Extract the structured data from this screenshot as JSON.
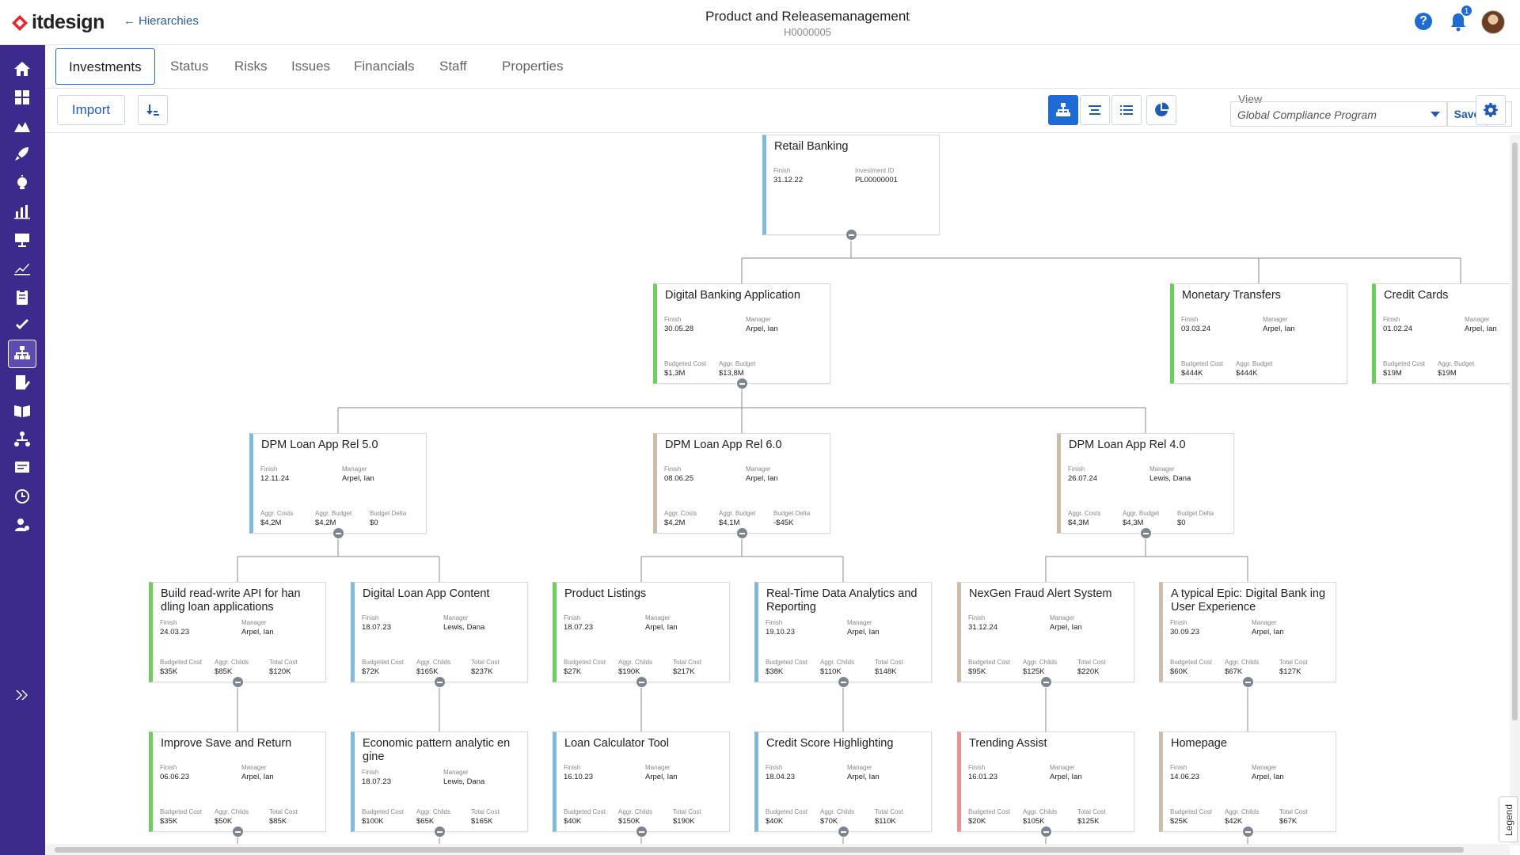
{
  "app": {
    "brand": "itdesign",
    "back_label": "Hierarchies",
    "title": "Product and Releasemanagement",
    "subtitle": "H0000005",
    "help_label": "?",
    "notifications_count": "1"
  },
  "tabs": [
    {
      "label": "Investments",
      "active": true
    },
    {
      "label": "Status",
      "active": false
    },
    {
      "label": "Risks",
      "active": false
    },
    {
      "label": "Issues",
      "active": false
    },
    {
      "label": "Financials",
      "active": false
    },
    {
      "label": "Staff",
      "active": false
    },
    {
      "label": "Properties",
      "active": false
    }
  ],
  "toolbar": {
    "import_label": "Import",
    "view_label": "View",
    "view_value": "Global Compliance Program",
    "save_label": "Save"
  },
  "legend_label": "Legend",
  "colors": {
    "sidebar": "#3d2a8c",
    "accent": "#1e6bd6",
    "green": "#6ccf5b",
    "blue": "#7fbad9",
    "tan": "#cbbda9",
    "red": "#ef8f8f"
  },
  "sidebar_icons": [
    "home-icon",
    "dashboard-icon",
    "landscape-icon",
    "rocket-icon",
    "idea-icon",
    "bar-chart-icon",
    "presentation-icon",
    "line-chart-icon",
    "clipboard-icon",
    "check-icon",
    "hierarchy-icon",
    "report-edit-icon",
    "book-icon",
    "org-chart-icon",
    "form-icon",
    "clock-icon",
    "settings-user-icon",
    "expand-icon"
  ],
  "nodes": [
    {
      "title": "Retail Banking",
      "color": "blue",
      "fields": [
        [
          "Finish",
          "31.12.22"
        ],
        [
          "Investment ID",
          "PL00000001"
        ]
      ],
      "bottom": []
    },
    {
      "title": "Digital Banking Application",
      "color": "green",
      "fields": [
        [
          "Finish",
          "30.05.28"
        ],
        [
          "Manager",
          "Arpel, Ian"
        ]
      ],
      "bottom": [
        [
          "Budgeted Cost",
          "$1,3M"
        ],
        [
          "Aggr. Budget",
          "$13,8M"
        ]
      ]
    },
    {
      "title": "Monetary Transfers",
      "color": "green",
      "fields": [
        [
          "Finish",
          "03.03.24"
        ],
        [
          "Manager",
          "Arpel, Ian"
        ]
      ],
      "bottom": [
        [
          "Budgeted Cost",
          "$444K"
        ],
        [
          "Aggr. Budget",
          "$444K"
        ]
      ]
    },
    {
      "title": "Credit Cards",
      "color": "green",
      "fields": [
        [
          "Finish",
          "01.02.24"
        ],
        [
          "Manager",
          "Arpel, Ian"
        ]
      ],
      "bottom": [
        [
          "Budgeted Cost",
          "$19M"
        ],
        [
          "Aggr. Budget",
          "$19M"
        ]
      ]
    },
    {
      "title": "DPM Loan App Rel 5.0",
      "color": "blue",
      "fields": [
        [
          "Finish",
          "12.11.24"
        ],
        [
          "Manager",
          "Arpel, Ian"
        ]
      ],
      "bottom": [
        [
          "Aggr. Costs",
          "$4,2M"
        ],
        [
          "Aggr. Budget",
          "$4,2M"
        ],
        [
          "Budget Delta",
          "$0"
        ]
      ]
    },
    {
      "title": "DPM Loan App Rel 6.0",
      "color": "tan",
      "fields": [
        [
          "Finish",
          "08.06.25"
        ],
        [
          "Manager",
          "Arpel, Ian"
        ]
      ],
      "bottom": [
        [
          "Aggr. Costs",
          "$4,2M"
        ],
        [
          "Aggr. Budget",
          "$4,1M"
        ],
        [
          "Budget Delta",
          "-$45K"
        ]
      ]
    },
    {
      "title": "DPM Loan App Rel 4.0",
      "color": "tan",
      "fields": [
        [
          "Finish",
          "26.07.24"
        ],
        [
          "Manager",
          "Lewis, Dana"
        ]
      ],
      "bottom": [
        [
          "Aggr. Costs",
          "$4,3M"
        ],
        [
          "Aggr. Budget",
          "$4,3M"
        ],
        [
          "Budget Delta",
          "$0"
        ]
      ]
    },
    {
      "title": "Build read-write API for han dling loan applications",
      "color": "green",
      "fields": [
        [
          "Finish",
          "24.03.23"
        ],
        [
          "Manager",
          "Arpel, Ian"
        ]
      ],
      "bottom": [
        [
          "Budgeted Cost",
          "$35K"
        ],
        [
          "Aggr. Childs",
          "$85K"
        ],
        [
          "Total Cost",
          "$120K"
        ]
      ]
    },
    {
      "title": "Digital Loan App Content",
      "color": "blue",
      "fields": [
        [
          "Finish",
          "18.07.23"
        ],
        [
          "Manager",
          "Lewis, Dana"
        ]
      ],
      "bottom": [
        [
          "Budgeted Cost",
          "$72K"
        ],
        [
          "Aggr. Childs",
          "$165K"
        ],
        [
          "Total Cost",
          "$237K"
        ]
      ]
    },
    {
      "title": "Product Listings",
      "color": "green",
      "fields": [
        [
          "Finish",
          "18.07.23"
        ],
        [
          "Manager",
          "Arpel, Ian"
        ]
      ],
      "bottom": [
        [
          "Budgeted Cost",
          "$27K"
        ],
        [
          "Aggr. Childs",
          "$190K"
        ],
        [
          "Total Cost",
          "$217K"
        ]
      ]
    },
    {
      "title": "Real-Time Data Analytics and Reporting",
      "color": "blue",
      "fields": [
        [
          "Finish",
          "19.10.23"
        ],
        [
          "Manager",
          "Arpel, Ian"
        ]
      ],
      "bottom": [
        [
          "Budgeted Cost",
          "$38K"
        ],
        [
          "Aggr. Childs",
          "$110K"
        ],
        [
          "Total Cost",
          "$148K"
        ]
      ]
    },
    {
      "title": "NexGen Fraud Alert System",
      "color": "tan",
      "fields": [
        [
          "Finish",
          "31.12.24"
        ],
        [
          "Manager",
          "Arpel, Ian"
        ]
      ],
      "bottom": [
        [
          "Budgeted Cost",
          "$95K"
        ],
        [
          "Aggr. Childs",
          "$125K"
        ],
        [
          "Total Cost",
          "$220K"
        ]
      ]
    },
    {
      "title": "A typical Epic: Digital Bank ing User Experience",
      "color": "tan",
      "fields": [
        [
          "Finish",
          "30.09.23"
        ],
        [
          "Manager",
          "Arpel, Ian"
        ]
      ],
      "bottom": [
        [
          "Budgeted Cost",
          "$60K"
        ],
        [
          "Aggr. Childs",
          "$67K"
        ],
        [
          "Total Cost",
          "$127K"
        ]
      ]
    },
    {
      "title": "Improve Save and Return",
      "color": "green",
      "fields": [
        [
          "Finish",
          "06.06.23"
        ],
        [
          "Manager",
          "Arpel, Ian"
        ]
      ],
      "bottom": [
        [
          "Budgeted Cost",
          "$35K"
        ],
        [
          "Aggr. Childs",
          "$50K"
        ],
        [
          "Total Cost",
          "$85K"
        ]
      ]
    },
    {
      "title": "Economic pattern analytic en gine",
      "color": "blue",
      "fields": [
        [
          "Finish",
          "18.07.23"
        ],
        [
          "Manager",
          "Lewis, Dana"
        ]
      ],
      "bottom": [
        [
          "Budgeted Cost",
          "$100K"
        ],
        [
          "Aggr. Childs",
          "$65K"
        ],
        [
          "Total Cost",
          "$165K"
        ]
      ]
    },
    {
      "title": "Loan Calculator Tool",
      "color": "blue",
      "fields": [
        [
          "Finish",
          "16.10.23"
        ],
        [
          "Manager",
          "Arpel, Ian"
        ]
      ],
      "bottom": [
        [
          "Budgeted Cost",
          "$40K"
        ],
        [
          "Aggr. Childs",
          "$150K"
        ],
        [
          "Total Cost",
          "$190K"
        ]
      ]
    },
    {
      "title": "Credit Score Highlighting",
      "color": "blue",
      "fields": [
        [
          "Finish",
          "18.04.23"
        ],
        [
          "Manager",
          "Arpel, Ian"
        ]
      ],
      "bottom": [
        [
          "Budgeted Cost",
          "$40K"
        ],
        [
          "Aggr. Childs",
          "$70K"
        ],
        [
          "Total Cost",
          "$110K"
        ]
      ]
    },
    {
      "title": "Trending Assist",
      "color": "red",
      "fields": [
        [
          "Finish",
          "16.01.23"
        ],
        [
          "Manager",
          "Arpel, Ian"
        ]
      ],
      "bottom": [
        [
          "Budgeted Cost",
          "$20K"
        ],
        [
          "Aggr. Childs",
          "$105K"
        ],
        [
          "Total Cost",
          "$125K"
        ]
      ]
    },
    {
      "title": "Homepage",
      "color": "tan",
      "fields": [
        [
          "Finish",
          "14.06.23"
        ],
        [
          "Manager",
          "Arpel, Ian"
        ]
      ],
      "bottom": [
        [
          "Budgeted Cost",
          "$25K"
        ],
        [
          "Aggr. Childs",
          "$42K"
        ],
        [
          "Total Cost",
          "$67K"
        ]
      ]
    }
  ]
}
